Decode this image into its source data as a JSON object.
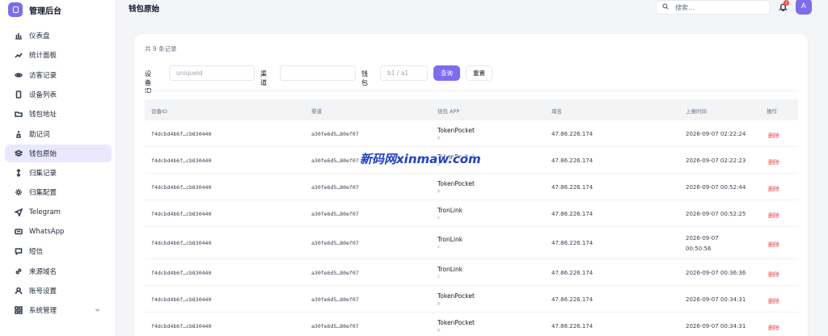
{
  "brand": {
    "title": "管理后台"
  },
  "sidebar": {
    "items": [
      {
        "label": "仪表盘",
        "icon": "bar-chart-icon"
      },
      {
        "label": "统计面板",
        "icon": "trend-icon"
      },
      {
        "label": "访客记录",
        "icon": "eye-icon"
      },
      {
        "label": "设备列表",
        "icon": "phone-icon"
      },
      {
        "label": "钱包地址",
        "icon": "folder-icon"
      },
      {
        "label": "助记词",
        "icon": "lock-icon"
      },
      {
        "label": "钱包原始",
        "icon": "layers-icon",
        "active": true
      },
      {
        "label": "归集记录",
        "icon": "arrows-icon"
      },
      {
        "label": "归集配置",
        "icon": "sun-gear-icon"
      },
      {
        "label": "Telegram",
        "icon": "send-icon"
      },
      {
        "label": "WhatsApp",
        "icon": "chat-icon"
      },
      {
        "label": "短信",
        "icon": "message-icon"
      },
      {
        "label": "来源域名",
        "icon": "link-icon"
      },
      {
        "label": "账号设置",
        "icon": "user-icon"
      },
      {
        "label": "系统管理",
        "icon": "grid-icon"
      }
    ]
  },
  "header": {
    "title": "钱包原始",
    "search_placeholder": "搜索...",
    "notification_count": "2",
    "avatar_letter": "A"
  },
  "filters": {
    "record_count": "共 9 条记录",
    "device_label": "设备ID",
    "device_placeholder": "uniqueId",
    "channel_label": "渠道",
    "channel_placeholder": "",
    "wallet_label": "钱包",
    "wallet_placeholder": "b1 / a1",
    "query_button": "查询",
    "reset_button": "重置"
  },
  "table": {
    "headers": [
      "设备ID",
      "渠道",
      "钱包 APP",
      "域名",
      "上报时间",
      "操作"
    ],
    "rows": [
      {
        "device": "f4dcbd4b6f…cb830440",
        "channel": "a30fe6d5…80ef07",
        "app": "TokenPocket",
        "app_sub": "p",
        "domain": "47.86.226.174",
        "time": "2026-09-07 02:22:24",
        "action": "删除"
      },
      {
        "device": "f4dcbd4b6f…cb830440",
        "channel": "a30fe6d5…80ef07",
        "app": "TokenPocket",
        "app_sub": "p",
        "domain": "47.86.226.174",
        "time": "2026-09-07 02:22:23",
        "action": "删除"
      },
      {
        "device": "f4dcbd4b6f…cb830440",
        "channel": "a30fe6d5…80ef07",
        "app": "TokenPocket",
        "app_sub": "p",
        "domain": "47.86.226.174",
        "time": "2026-09-07 00:52:44",
        "action": "删除"
      },
      {
        "device": "f4dcbd4b6f…cb830440",
        "channel": "a30fe6d5…80ef07",
        "app": "TronLink",
        "app_sub": "c",
        "domain": "47.86.226.174",
        "time": "2026-09-07 00:52:25",
        "action": "删除"
      },
      {
        "device": "f4dcbd4b6f…cb830440",
        "channel": "a30fe6d5…80ef07",
        "app": "TronLink",
        "app_sub": "c",
        "domain": "47.86.226.174",
        "time": "2026-09-07",
        "time2": "00:50:56",
        "action": "删除"
      },
      {
        "device": "f4dcbd4b6f…cb830440",
        "channel": "a30fe6d5…80ef07",
        "app": "TronLink",
        "app_sub": "c",
        "domain": "47.86.226.174",
        "time": "2026-09-07 00:36:36",
        "action": "删除"
      },
      {
        "device": "f4dcbd4b6f…cb830440",
        "channel": "a30fe6d5…80ef07",
        "app": "TokenPocket",
        "app_sub": "p",
        "domain": "47.86.226.174",
        "time": "2026-09-07 00:34:31",
        "action": "删除"
      },
      {
        "device": "f4dcbd4b6f…cb830440",
        "channel": "a30fe6d5…80ef07",
        "app": "TokenPocket",
        "app_sub": "p",
        "domain": "47.86.226.174",
        "time": "2026-09-07 00:34:31",
        "action": "删除"
      }
    ]
  },
  "watermark": "新码网xinmaw.com",
  "colors": {
    "accent": "#7c6cf0",
    "danger": "#ef4444",
    "active_bg": "#ebe8fd"
  }
}
